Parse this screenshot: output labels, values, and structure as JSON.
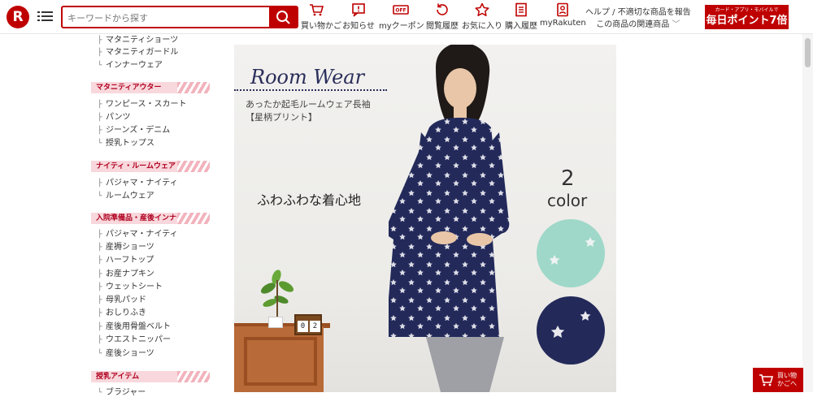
{
  "header": {
    "logo_letter": "R",
    "search_placeholder": "キーワードから探す",
    "nav": [
      {
        "label": "買い物かご",
        "icon": "cart-icon"
      },
      {
        "label": "お知らせ",
        "icon": "notice-icon"
      },
      {
        "label": "myクーポン",
        "icon": "coupon-icon"
      },
      {
        "label": "閲覧履歴",
        "icon": "history-icon"
      },
      {
        "label": "お気に入り",
        "icon": "star-icon"
      },
      {
        "label": "購入履歴",
        "icon": "purchase-history-icon"
      },
      {
        "label": "myRakuten",
        "icon": "user-icon"
      }
    ],
    "help": "ヘルプ / 不適切な商品を報告",
    "related": "この商品の関連商品",
    "promo_small": "カード・アプリ・モバイルで",
    "promo_big": "毎日ポイント7倍",
    "coupon_badge": "OFF"
  },
  "sidebar": {
    "top_items": [
      "マタニティショーツ",
      "マタニティガードル",
      "インナーウェア"
    ],
    "categories": [
      {
        "title": "マタニティアウター",
        "items": [
          "ワンピース・スカート",
          "パンツ",
          "ジーンズ・デニム",
          "授乳トップス"
        ]
      },
      {
        "title": "ナイティ・ルームウェア",
        "items": [
          "パジャマ・ナイティ",
          "ルームウェア"
        ]
      },
      {
        "title": "入院準備品・産後インナー",
        "items": [
          "パジャマ・ナイティ",
          "産褥ショーツ",
          "ハーフトップ",
          "お産ナプキン",
          "ウェットシート",
          "母乳パッド",
          "おしりふき",
          "産後用骨盤ベルト",
          "ウエストニッパー",
          "産後ショーツ"
        ]
      },
      {
        "title": "授乳アイテム",
        "items": [
          "ブラジャー"
        ]
      }
    ]
  },
  "banner": {
    "title": "Room Wear",
    "subtitle_1": "あったか起毛ルームウェア長袖",
    "subtitle_2": "【星柄プリント】",
    "catch": "ふわふわな着心地",
    "color_count": "2",
    "color_label": "color",
    "calendar_1": "0",
    "calendar_2": "2",
    "colors": {
      "mint": "#9fd8c8",
      "navy": "#232a5a"
    }
  },
  "floating_cart": {
    "label_1": "買い物",
    "label_2": "かごへ"
  }
}
